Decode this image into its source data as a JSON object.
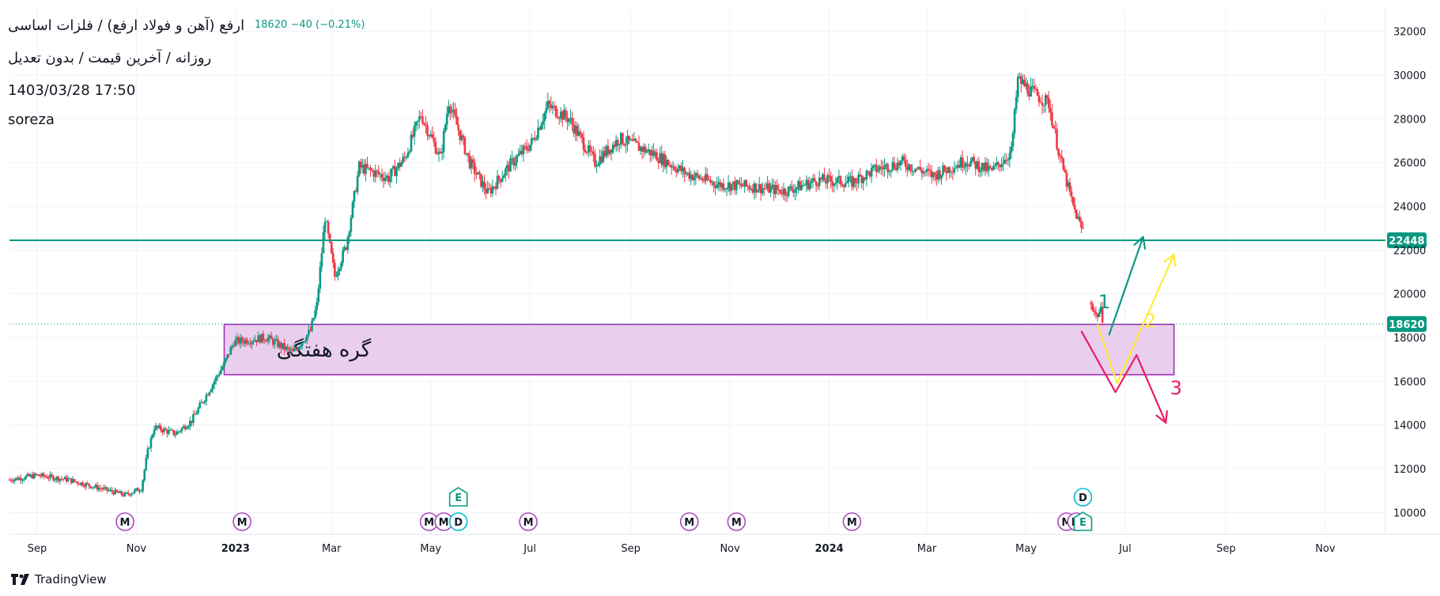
{
  "header": {
    "symbol_line": "ارفع (آهن و فولاد ارفع) / فلزات اساسی",
    "interval_line": "روزانه / آخرین قیمت / بدون تعدیل",
    "datetime": "1403/03/28 17:50",
    "author": "soreza",
    "quote": "18620  −40 (−0.21%)"
  },
  "brand": {
    "name": "TradingView"
  },
  "colors": {
    "up": "#089981",
    "down": "#f23645",
    "zone_fill": "#e1bee7",
    "zone_border": "#9c27b0",
    "level_line": "#089981",
    "arrow_1": "#089981",
    "arrow_2": "#ffeb3b",
    "arrow_3": "#e91e63",
    "axis_text": "#131722",
    "grid": "#f0f3fa"
  },
  "chart_data": {
    "type": "candlestick",
    "x_range": [
      "2022-08-15",
      "2024-12-08"
    ],
    "ylim": [
      9000,
      33000
    ],
    "y_ticks": [
      10000,
      12000,
      14000,
      16000,
      18000,
      20000,
      22000,
      24000,
      26000,
      28000,
      30000,
      32000
    ],
    "x_tick_labels": [
      {
        "date": "2022-09-01",
        "label": "Sep",
        "bold": false
      },
      {
        "date": "2022-11-01",
        "label": "Nov",
        "bold": false
      },
      {
        "date": "2023-01-01",
        "label": "2023",
        "bold": true
      },
      {
        "date": "2023-03-01",
        "label": "Mar",
        "bold": false
      },
      {
        "date": "2023-05-01",
        "label": "May",
        "bold": false
      },
      {
        "date": "2023-07-01",
        "label": "Jul",
        "bold": false
      },
      {
        "date": "2023-09-01",
        "label": "Sep",
        "bold": false
      },
      {
        "date": "2023-11-01",
        "label": "Nov",
        "bold": false
      },
      {
        "date": "2024-01-01",
        "label": "2024",
        "bold": true
      },
      {
        "date": "2024-03-01",
        "label": "Mar",
        "bold": false
      },
      {
        "date": "2024-05-01",
        "label": "May",
        "bold": false
      },
      {
        "date": "2024-07-01",
        "label": "Jul",
        "bold": false
      },
      {
        "date": "2024-09-01",
        "label": "Sep",
        "bold": false
      },
      {
        "date": "2024-11-01",
        "label": "Nov",
        "bold": false
      }
    ],
    "price_path": [
      [
        "2022-08-15",
        11500
      ],
      [
        "2022-09-01",
        11700
      ],
      [
        "2022-09-20",
        11500
      ],
      [
        "2022-10-10",
        11100
      ],
      [
        "2022-10-25",
        10800
      ],
      [
        "2022-11-04",
        11100
      ],
      [
        "2022-11-08",
        12800
      ],
      [
        "2022-11-12",
        13900
      ],
      [
        "2022-11-25",
        13600
      ],
      [
        "2022-12-05",
        14200
      ],
      [
        "2022-12-15",
        15500
      ],
      [
        "2022-12-25",
        16800
      ],
      [
        "2022-12-31",
        17800
      ],
      [
        "2023-01-20",
        18000
      ],
      [
        "2023-02-05",
        17300
      ],
      [
        "2023-02-16",
        18300
      ],
      [
        "2023-02-20",
        19500
      ],
      [
        "2023-02-25",
        23500
      ],
      [
        "2023-03-03",
        20800
      ],
      [
        "2023-03-10",
        22200
      ],
      [
        "2023-03-18",
        25800
      ],
      [
        "2023-04-05",
        25300
      ],
      [
        "2023-04-15",
        26200
      ],
      [
        "2023-04-25",
        28200
      ],
      [
        "2023-05-07",
        26200
      ],
      [
        "2023-05-12",
        28800
      ],
      [
        "2023-05-25",
        26000
      ],
      [
        "2023-06-05",
        24600
      ],
      [
        "2023-06-20",
        26000
      ],
      [
        "2023-07-02",
        26900
      ],
      [
        "2023-07-12",
        28600
      ],
      [
        "2023-07-25",
        28000
      ],
      [
        "2023-08-10",
        26000
      ],
      [
        "2023-08-25",
        27100
      ],
      [
        "2023-09-15",
        26400
      ],
      [
        "2023-10-05",
        25500
      ],
      [
        "2023-10-25",
        25000
      ],
      [
        "2023-11-15",
        24900
      ],
      [
        "2023-12-05",
        24700
      ],
      [
        "2023-12-25",
        25200
      ],
      [
        "2024-01-15",
        25100
      ],
      [
        "2024-01-30",
        25700
      ],
      [
        "2024-02-15",
        26000
      ],
      [
        "2024-03-05",
        25400
      ],
      [
        "2024-03-25",
        26100
      ],
      [
        "2024-04-10",
        25600
      ],
      [
        "2024-04-22",
        26500
      ],
      [
        "2024-04-26",
        29800
      ],
      [
        "2024-05-05",
        29200
      ],
      [
        "2024-05-15",
        28700
      ],
      [
        "2024-05-22",
        26200
      ],
      [
        "2024-05-30",
        24000
      ],
      [
        "2024-06-04",
        23000
      ],
      [
        "2024-06-06",
        22900
      ]
    ],
    "second_segment": [
      [
        "2024-06-10",
        19600
      ],
      [
        "2024-06-13",
        19000
      ],
      [
        "2024-06-16",
        19200
      ],
      [
        "2024-06-18",
        18600
      ]
    ],
    "horizontal_levels": [
      {
        "value": 22448,
        "label": "22448",
        "style": "solid"
      },
      {
        "value": 18620,
        "label": "18620",
        "style": "dotted"
      }
    ],
    "zone": {
      "label": "گره هفتگی",
      "x0": "2022-12-25",
      "x1": "2024-07-31",
      "y0": 16300,
      "y1": 18600
    },
    "scenarios": [
      {
        "label": "1",
        "color": "#089981",
        "points": [
          [
            "2024-06-21",
            18100
          ],
          [
            "2024-07-12",
            22600
          ]
        ]
      },
      {
        "label": "2",
        "color": "#ffeb3b",
        "points": [
          [
            "2024-06-14",
            18600
          ],
          [
            "2024-06-26",
            15900
          ],
          [
            "2024-07-31",
            21800
          ]
        ]
      },
      {
        "label": "3",
        "color": "#e91e63",
        "points": [
          [
            "2024-06-04",
            18300
          ],
          [
            "2024-06-25",
            15500
          ],
          [
            "2024-07-08",
            17200
          ],
          [
            "2024-07-26",
            14100
          ]
        ]
      }
    ],
    "event_markers": [
      {
        "date": "2022-10-25",
        "type": "M",
        "row": "bottom"
      },
      {
        "date": "2023-01-05",
        "type": "M",
        "row": "bottom"
      },
      {
        "date": "2023-04-30",
        "type": "M",
        "row": "bottom"
      },
      {
        "date": "2023-05-09",
        "type": "M",
        "row": "bottom"
      },
      {
        "date": "2023-05-18",
        "type": "D",
        "row": "bottom"
      },
      {
        "date": "2023-05-18",
        "type": "E",
        "row": "top"
      },
      {
        "date": "2023-06-30",
        "type": "M",
        "row": "bottom"
      },
      {
        "date": "2023-10-07",
        "type": "M",
        "row": "bottom"
      },
      {
        "date": "2023-11-05",
        "type": "M",
        "row": "bottom"
      },
      {
        "date": "2024-01-15",
        "type": "M",
        "row": "bottom"
      },
      {
        "date": "2024-05-26",
        "type": "M",
        "row": "bottom"
      },
      {
        "date": "2024-06-01",
        "type": "M",
        "row": "bottom"
      },
      {
        "date": "2024-06-05",
        "type": "E",
        "row": "bottom"
      },
      {
        "date": "2024-06-05",
        "type": "D",
        "row": "top"
      }
    ]
  }
}
